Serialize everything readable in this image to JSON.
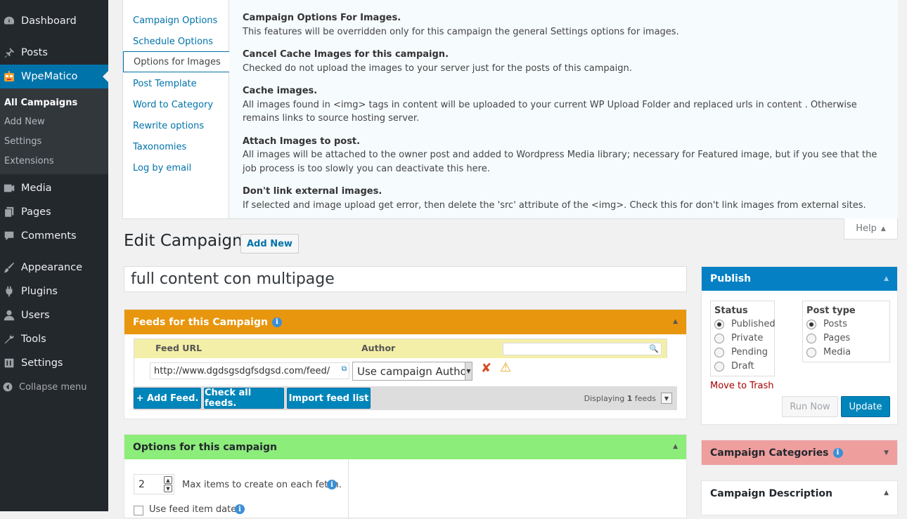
{
  "sidebar": {
    "menu": [
      {
        "label": "Dashboard",
        "icon": "dashboard-icon"
      },
      {
        "label": "Posts",
        "icon": "pushpin-icon"
      },
      {
        "label": "WpeMatico",
        "icon": "wpematico-robot-icon"
      },
      {
        "label": "Media",
        "icon": "media-icon"
      },
      {
        "label": "Pages",
        "icon": "pages-icon"
      },
      {
        "label": "Comments",
        "icon": "comments-icon"
      },
      {
        "label": "Appearance",
        "icon": "paintbrush-icon"
      },
      {
        "label": "Plugins",
        "icon": "plugin-icon"
      },
      {
        "label": "Users",
        "icon": "users-icon"
      },
      {
        "label": "Tools",
        "icon": "wrench-icon"
      },
      {
        "label": "Settings",
        "icon": "settings-icon"
      }
    ],
    "submenu": [
      "All Campaigns",
      "Add New",
      "Settings",
      "Extensions"
    ],
    "collapse_label": "Collapse menu"
  },
  "help": {
    "tabs": [
      "Campaign Options",
      "Schedule Options",
      "Options for Images",
      "Post Template",
      "Word to Category",
      "Rewrite options",
      "Taxonomies",
      "Log by email"
    ],
    "sections": [
      {
        "title": "Campaign Options For Images.",
        "text": "This features will be overridden only for this campaign the general Settings options for images."
      },
      {
        "title": "Cancel Cache Images for this campaign.",
        "text": "Checked do not upload the images to your server just for the posts of this campaign."
      },
      {
        "title": "Cache images.",
        "text": "All images found in <img> tags in content will be uploaded to your current WP Upload Folder and replaced urls in content . Otherwise remains links to source hosting server."
      },
      {
        "title": "Attach Images to post.",
        "text": "All images will be attached to the owner post and added to Wordpress Media library; necessary for Featured image, but if you see that the job process is too slowly you can deactivate this here."
      },
      {
        "title": "Don't link external images.",
        "text": "If selected and image upload get error, then delete the 'src' attribute of the <img>. Check this for don't link images from external sites."
      }
    ],
    "toggle_label": "Help"
  },
  "page": {
    "title": "Edit Campaign",
    "add_new": "Add New",
    "campaign_title": "full content con multipage"
  },
  "feeds": {
    "header": "Feeds for this Campaign",
    "col_feed_url": "Feed URL",
    "col_author": "Author",
    "feed_url": "http://www.dgdsgsdgfsdgsd.com/feed/",
    "author": "Use campaign Author",
    "add_feed": "+ Add Feed.",
    "check_all": "Check all feeds.",
    "import": "Import feed list",
    "displaying_prefix": "Displaying",
    "displaying_count": "1",
    "displaying_suffix": "feeds"
  },
  "options": {
    "header": "Options for this campaign",
    "max_items": "2",
    "max_items_label": "Max items to create on each fetch.",
    "use_feed_date": "Use feed item date"
  },
  "publish": {
    "header": "Publish",
    "status_title": "Status",
    "statuses": [
      "Published",
      "Private",
      "Pending",
      "Draft"
    ],
    "post_type_title": "Post type",
    "post_types": [
      "Posts",
      "Pages",
      "Media"
    ],
    "move_trash": "Move to Trash",
    "run_now": "Run Now",
    "update": "Update"
  },
  "categories": {
    "header": "Campaign Categories"
  },
  "description": {
    "header": "Campaign Description"
  },
  "colors": {
    "sidebar_bg": "#23282d",
    "accent_blue": "#0073aa",
    "feeds_header": "#e8960e",
    "options_header": "#8ced7a",
    "categories_header": "#ef9e9e",
    "publish_header": "#0580c4"
  }
}
